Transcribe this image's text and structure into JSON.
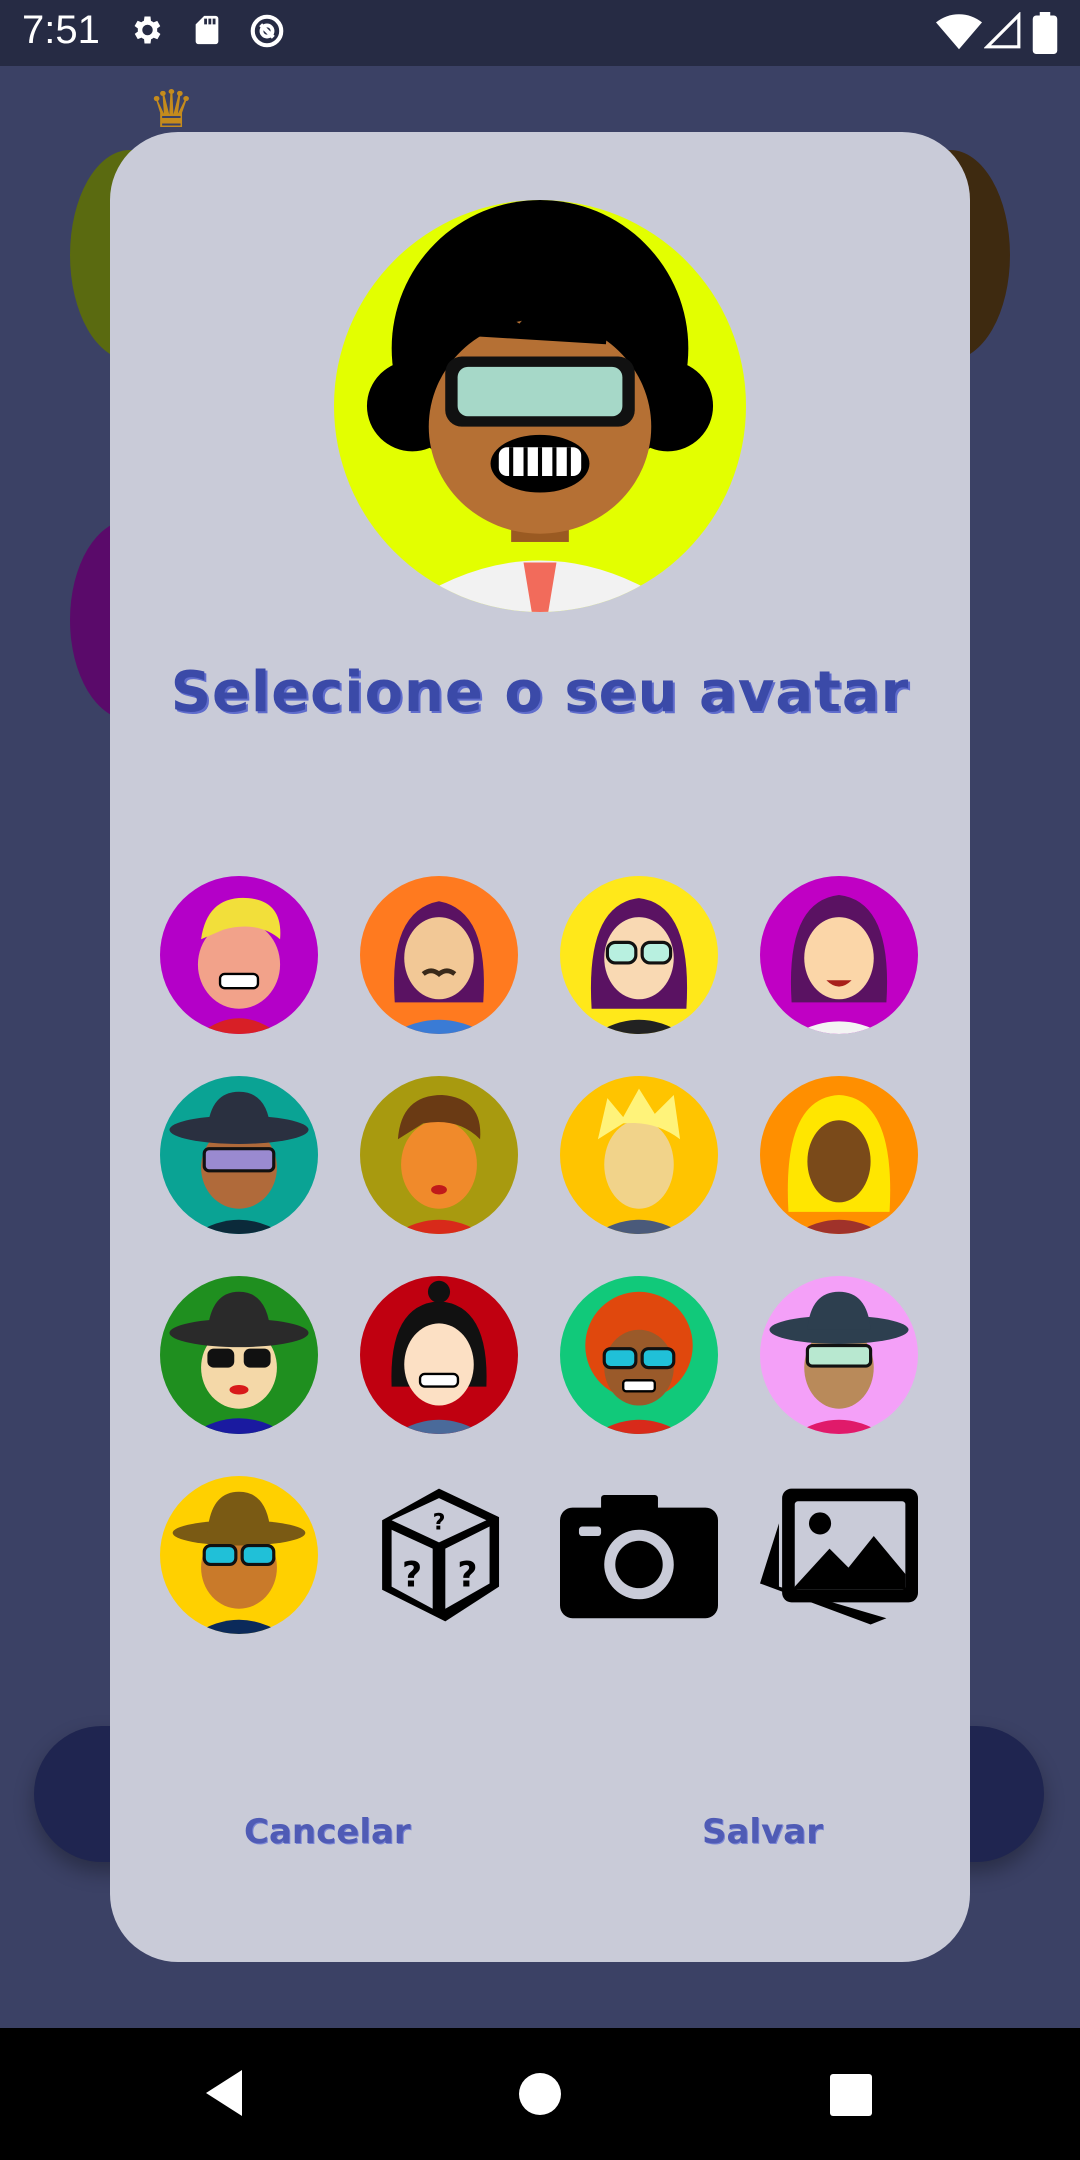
{
  "status_bar": {
    "time": "7:51",
    "left_icons": [
      "settings-icon",
      "sd-card-icon",
      "vpn-key-icon"
    ],
    "right_icons": [
      "wifi-icon",
      "signal-icon",
      "battery-icon"
    ]
  },
  "dialog": {
    "title": "Selecione o seu avatar",
    "selected_avatar_bg": "#e3ff00",
    "avatars": [
      {
        "name": "avatar-1",
        "bg": "#b400c8",
        "hair": "#f2df3a",
        "skin": "#f2a28a"
      },
      {
        "name": "avatar-2",
        "bg": "#ff7a1f",
        "hair": "#5a1262",
        "skin": "#f2c896"
      },
      {
        "name": "avatar-3",
        "bg": "#ffe81a",
        "hair": "#5a1262",
        "skin": "#f9d9b3"
      },
      {
        "name": "avatar-4",
        "bg": "#c000c4",
        "hair": "#5a1262",
        "skin": "#fbd6a8"
      },
      {
        "name": "avatar-5",
        "bg": "#0aa394",
        "hair": "#2a3040",
        "skin": "#b06a3a"
      },
      {
        "name": "avatar-6",
        "bg": "#a89a0f",
        "hair": "#6a3a14",
        "skin": "#f08a2b"
      },
      {
        "name": "avatar-7",
        "bg": "#ffc400",
        "hair": "#fff37a",
        "skin": "#f1d38a"
      },
      {
        "name": "avatar-8",
        "bg": "#ff8f00",
        "hair": "#ffe600",
        "skin": "#7a4a1a"
      },
      {
        "name": "avatar-9",
        "bg": "#1f8f1f",
        "hair": "#2a2a2a",
        "skin": "#f4d8a8"
      },
      {
        "name": "avatar-10",
        "bg": "#c00010",
        "hair": "#111111",
        "skin": "#fce0c4"
      },
      {
        "name": "avatar-11",
        "bg": "#11c97a",
        "hair": "#e0480d",
        "skin": "#9a5a2a"
      },
      {
        "name": "avatar-12",
        "bg": "#f4a0f8",
        "hair": "#2d3f4f",
        "skin": "#b98a5a"
      },
      {
        "name": "avatar-13",
        "bg": "#ffd000",
        "hair": "#7a5a14",
        "skin": "#c97a2a"
      }
    ],
    "action_icons": [
      "random-dice-icon",
      "camera-icon",
      "gallery-icon"
    ],
    "cancel_label": "Cancelar",
    "save_label": "Salvar"
  },
  "nav_bar": {
    "icons": [
      "back-icon",
      "home-icon",
      "recents-icon"
    ]
  },
  "colors": {
    "background": "#3b4165",
    "dialog": "#c9cbd8",
    "accent": "#3b4aa8"
  }
}
